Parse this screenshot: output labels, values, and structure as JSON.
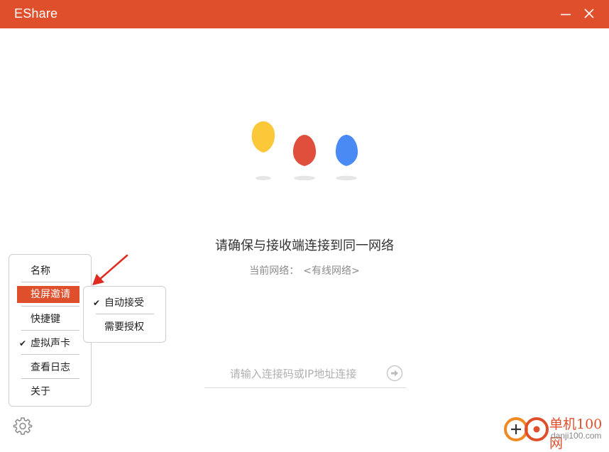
{
  "app": {
    "title": "EShare",
    "accent_color": "#e04f2c"
  },
  "window_controls": {
    "minimize_icon": "minimize-icon",
    "close_icon": "close-icon"
  },
  "hero": {
    "drops": [
      {
        "color": "#fbc83a",
        "icon": "yellow-drop-icon"
      },
      {
        "color": "#e04f3c",
        "icon": "red-drop-icon"
      },
      {
        "color": "#4a8af4",
        "icon": "blue-drop-icon"
      }
    ]
  },
  "main": {
    "headline": "请确保与接收端连接到同一网络",
    "network_label": "当前网络：",
    "network_value": "<有线网络>"
  },
  "connect": {
    "placeholder": "请输入连接码或IP地址连接",
    "value": "",
    "go_icon": "arrow-right-circle-icon"
  },
  "settings_menu": {
    "items": [
      {
        "label": "名称",
        "checked": false,
        "active": false
      },
      {
        "label": "投屏邀请",
        "checked": false,
        "active": true,
        "has_submenu": true
      },
      {
        "label": "快捷键",
        "checked": false,
        "active": false
      },
      {
        "label": "虚拟声卡",
        "checked": true,
        "active": false
      },
      {
        "label": "查看日志",
        "checked": false,
        "active": false
      },
      {
        "label": "关于",
        "checked": false,
        "active": false
      }
    ],
    "submenu": [
      {
        "label": "自动接受",
        "checked": true
      },
      {
        "label": "需要授权",
        "checked": false
      }
    ],
    "check_glyph": "✔"
  },
  "footer": {
    "settings_icon": "gear-icon"
  },
  "watermark": {
    "name": "单机100网",
    "url": "danji100.com"
  }
}
